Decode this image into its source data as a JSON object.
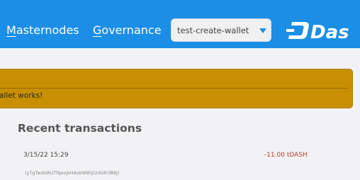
{
  "nav": {
    "masternodes": {
      "first": "M",
      "rest": "asternodes"
    },
    "governance": {
      "first": "G",
      "rest": "overnance"
    }
  },
  "wallet_select": {
    "value": "test-create-wallet",
    "icon": "chevron-down-icon"
  },
  "logo": {
    "text": "Dash"
  },
  "banner": {
    "message": "allet works!"
  },
  "recent": {
    "title": "Recent transactions",
    "transactions": [
      {
        "date": "3/15/22 15:29",
        "amount": "-11.00 tDASH",
        "address": "(yTgTwddAUTfqeojsHAob9Nhjt2dGR3B8J)"
      }
    ]
  },
  "colors": {
    "brand": "#1b8ee6",
    "banner": "#c88f03",
    "negative_amount": "#b43c2c",
    "background": "#f2f2f4"
  }
}
